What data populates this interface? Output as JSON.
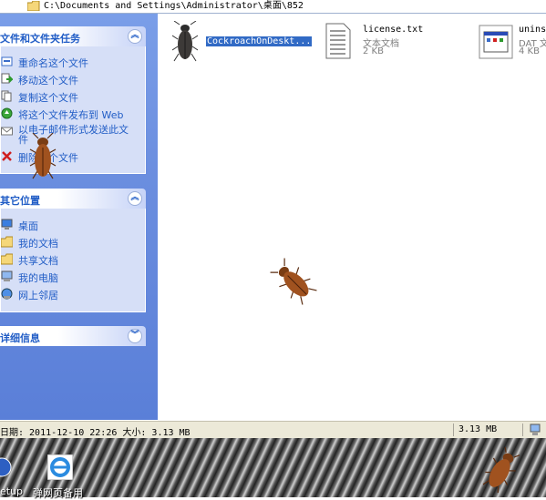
{
  "address": {
    "path": "C:\\Documents and Settings\\Administrator\\桌面\\852"
  },
  "tasks": {
    "title": "文件和文件夹任务",
    "items": [
      {
        "label": "重命名这个文件",
        "icon": "rename-icon"
      },
      {
        "label": "移动这个文件",
        "icon": "move-icon"
      },
      {
        "label": "复制这个文件",
        "icon": "copy-icon"
      },
      {
        "label": "将这个文件发布到 Web",
        "icon": "publish-web-icon"
      },
      {
        "label": "以电子邮件形式发送此文件",
        "icon": "email-icon"
      },
      {
        "label": "删除这个文件",
        "icon": "delete-icon"
      }
    ]
  },
  "places": {
    "title": "其它位置",
    "items": [
      {
        "label": "桌面",
        "icon": "desktop-icon"
      },
      {
        "label": "我的文档",
        "icon": "my-documents-icon"
      },
      {
        "label": "共享文档",
        "icon": "shared-documents-icon"
      },
      {
        "label": "我的电脑",
        "icon": "my-computer-icon"
      },
      {
        "label": "网上邻居",
        "icon": "network-places-icon"
      }
    ]
  },
  "details": {
    "title": "详细信息"
  },
  "files": [
    {
      "name": "CockroachOnDeskt...",
      "type": "",
      "size": "",
      "icon": "cockroach-exe-icon",
      "selected": true
    },
    {
      "name": "license.txt",
      "type": "文本文档",
      "size": "2 KB",
      "icon": "text-document-icon"
    },
    {
      "name": "unins",
      "type": "DAT 文",
      "size": "4 KB",
      "icon": "dat-file-icon"
    }
  ],
  "status": {
    "left": "日期: 2011-12-10 22:26 大小: 3.13 MB",
    "right": "3.13 MB"
  },
  "desktop": {
    "icons": [
      {
        "label": "etup",
        "icon": "setup-icon"
      },
      {
        "label": "弹网页备用",
        "icon": "ie-icon"
      }
    ]
  },
  "colors": {
    "link": "#215dc6",
    "pane": "#6b8edf",
    "selection": "#316ac5"
  }
}
